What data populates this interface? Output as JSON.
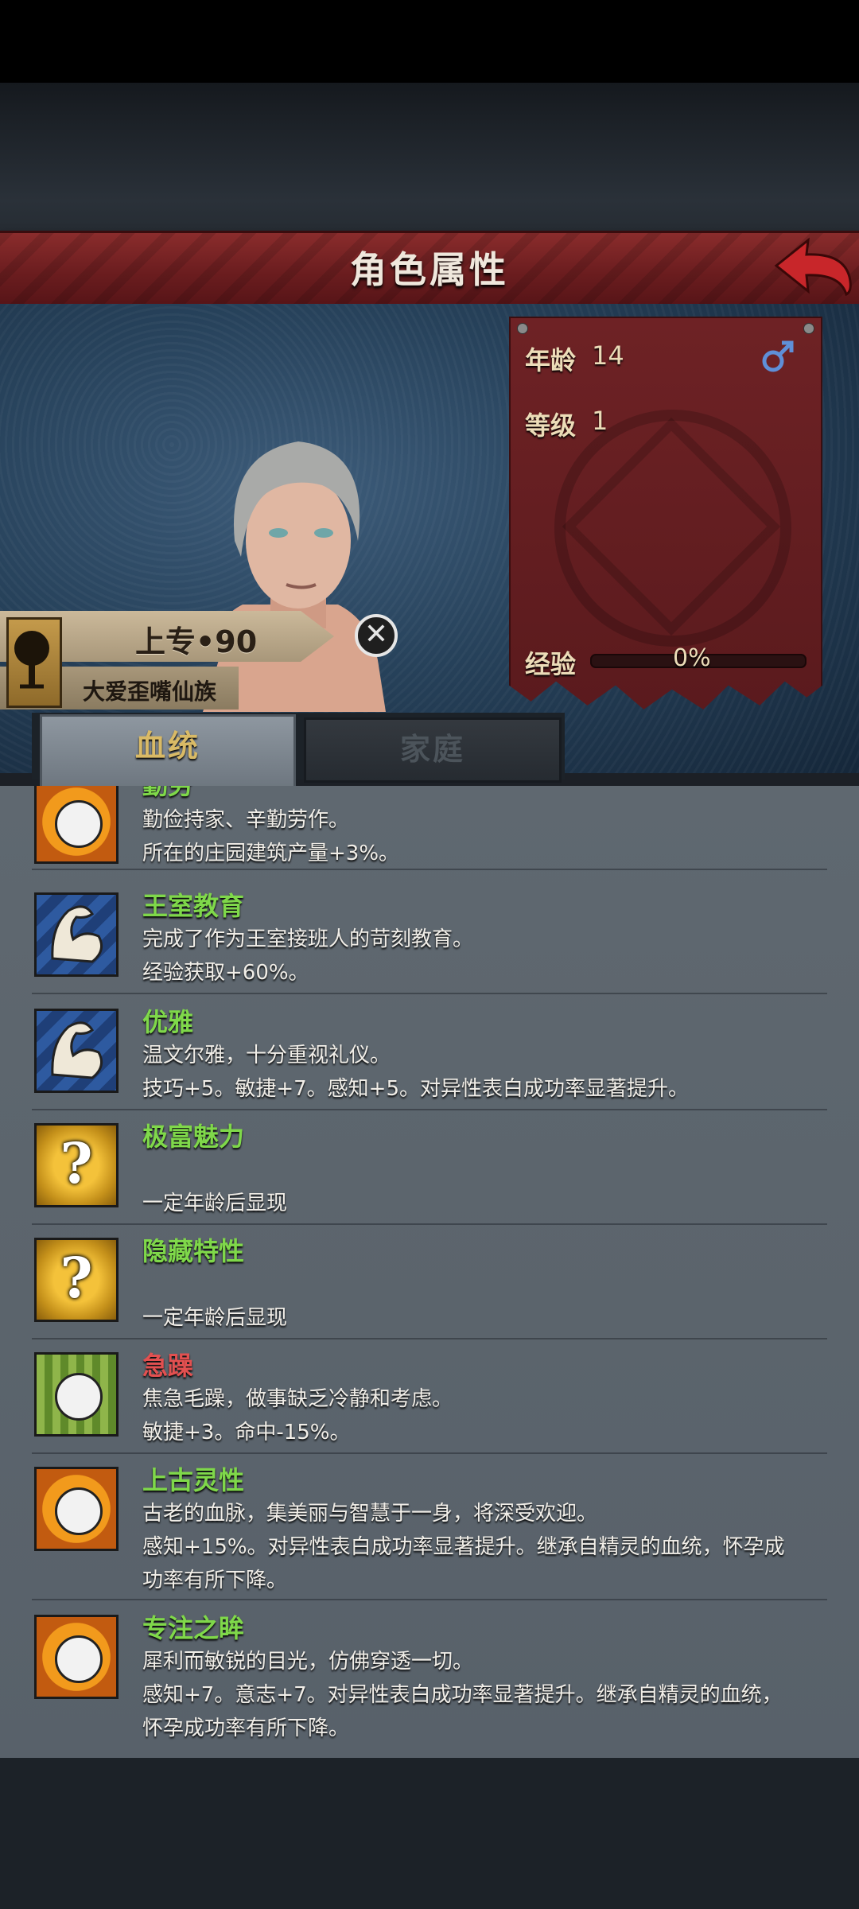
{
  "header": {
    "title": "角色属性"
  },
  "stats": {
    "age_label": "年龄",
    "age_value": "14",
    "level_label": "等级",
    "level_value": "1",
    "exp_label": "经验",
    "exp_percent": "0%",
    "exp_progress": 0
  },
  "character": {
    "name": "上专•90",
    "clan": "大爱歪嘴仙族"
  },
  "tabs": [
    {
      "label": "血统",
      "active": true
    },
    {
      "label": "家庭",
      "active": false
    }
  ],
  "traits": [
    {
      "name": "勤劳",
      "icon": "happy-sun-icon",
      "name_color": "green",
      "lines": [
        "勤俭持家、辛勤劳作。",
        "所在的庄园建筑产量+3%。"
      ]
    },
    {
      "name": "王室教育",
      "icon": "flexed-arm-icon",
      "name_color": "green",
      "lines": [
        "完成了作为王室接班人的苛刻教育。",
        "经验获取+60%。"
      ]
    },
    {
      "name": "优雅",
      "icon": "flexed-arm-icon",
      "name_color": "green",
      "lines": [
        "温文尔雅，十分重视礼仪。",
        "技巧+5。敏捷+7。感知+5。对异性表白成功率显著提升。"
      ]
    },
    {
      "name": "极富魅力",
      "icon": "question-mark-icon",
      "name_color": "green",
      "lines": [
        "",
        "一定年龄后显现"
      ]
    },
    {
      "name": "隐藏特性",
      "icon": "question-mark-icon",
      "name_color": "green",
      "lines": [
        "",
        "一定年龄后显现"
      ]
    },
    {
      "name": "急躁",
      "icon": "sad-face-icon",
      "name_color": "red",
      "lines": [
        "焦急毛躁，做事缺乏冷静和考虑。",
        "敏捷+3。命中-15%。"
      ]
    },
    {
      "name": "上古灵性",
      "icon": "happy-sun-icon",
      "name_color": "green",
      "lines": [
        "古老的血脉，集美丽与智慧于一身，将深受欢迎。",
        "感知+15%。对异性表白成功率显著提升。继承自精灵的血统，怀孕成",
        "功率有所下降。"
      ]
    },
    {
      "name": "专注之眸",
      "icon": "happy-sun-icon",
      "name_color": "green",
      "lines": [
        "犀利而敏锐的目光，仿佛穿透一切。",
        "感知+7。意志+7。对异性表白成功率显著提升。继承自精灵的血统，",
        "怀孕成功率有所下降。"
      ]
    }
  ],
  "colors": {
    "trait_green": "#7fd84a",
    "trait_red": "#e25050",
    "title_bar": "#6b1d1f"
  }
}
